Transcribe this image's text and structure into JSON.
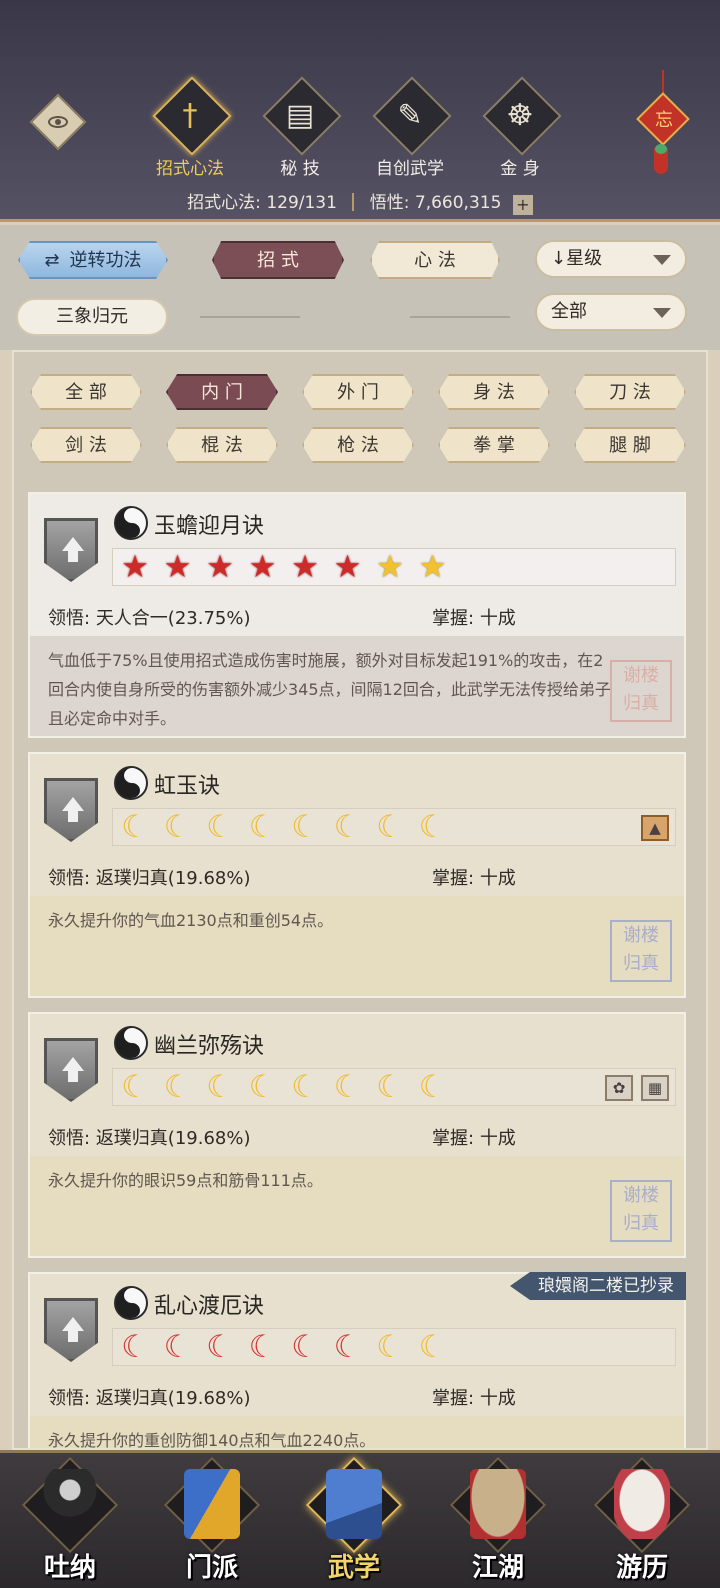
{
  "header": {
    "tabs": [
      {
        "label": "招式心法",
        "icon": "sword-icon",
        "glyph": "†",
        "active": true
      },
      {
        "label": "秘 技",
        "icon": "book-icon",
        "glyph": "▤",
        "active": false
      },
      {
        "label": "自创武学",
        "icon": "scroll-brush-icon",
        "glyph": "✎",
        "active": false
      },
      {
        "label": "金 身",
        "icon": "meditation-icon",
        "glyph": "☸",
        "active": false
      }
    ],
    "knot_char": "忘",
    "stats": {
      "count_label": "招式心法:",
      "count_value": "129/131",
      "insight_label": "悟性:",
      "insight_value": "7,660,315",
      "plus": "+"
    }
  },
  "filters": {
    "reverse_label": "逆转功法",
    "reverse_icon": "⇄",
    "moves_label": "招 式",
    "mind_label": "心 法",
    "sort_label": "↓星级",
    "sanxiang_label": "三象归元",
    "all_label": "全部"
  },
  "categories": [
    "全 部",
    "内 门",
    "外 门",
    "身 法",
    "刀 法",
    "剑 法",
    "棍 法",
    "枪 法",
    "拳 掌",
    "腿 脚"
  ],
  "active_category": 1,
  "field_labels": {
    "comprehension": "领悟:",
    "mastery": "掌握:"
  },
  "skills": [
    {
      "name": "玉蟾迎月诀",
      "marks": [
        "star-red",
        "star-red",
        "star-red",
        "star-red",
        "star-red",
        "star-red",
        "star-gold",
        "star-gold"
      ],
      "comprehension": "天人合一(23.75%)",
      "mastery": "十成",
      "description": "气血低于75%且使用招式造成伤害时施展，额外对目标发起191%的攻击，在2回合内使自身所受的伤害额外减少345点，间隔12回合，此武学无法传授给弟子且必定命中对手。",
      "seal": "谢楼 归真",
      "tags": [],
      "ribbon": ""
    },
    {
      "name": "虹玉诀",
      "marks": [
        "moon-gold",
        "moon-gold",
        "moon-gold",
        "moon-gold",
        "moon-gold",
        "moon-gold",
        "moon-gold",
        "moon-gold"
      ],
      "comprehension": "返璞归真(19.68%)",
      "mastery": "十成",
      "description": "永久提升你的气血2130点和重创54点。",
      "seal": "谢楼 归真",
      "tags": [
        "mountain-icon"
      ],
      "ribbon": ""
    },
    {
      "name": "幽兰弥殇诀",
      "marks": [
        "moon-gold",
        "moon-gold",
        "moon-gold",
        "moon-gold",
        "moon-gold",
        "moon-gold",
        "moon-gold",
        "moon-gold"
      ],
      "comprehension": "返璞归真(19.68%)",
      "mastery": "十成",
      "description": "永久提升你的眼识59点和筋骨111点。",
      "seal": "谢楼 归真",
      "tags": [
        "flower-icon",
        "tile-icon"
      ],
      "ribbon": ""
    },
    {
      "name": "乱心渡厄诀",
      "marks": [
        "moon-red",
        "moon-red",
        "moon-red",
        "moon-red",
        "moon-red",
        "moon-red",
        "moon-gold",
        "moon-gold"
      ],
      "comprehension": "返璞归真(19.68%)",
      "mastery": "十成",
      "description": "永久提升你的重创防御140点和气血2240点。",
      "seal": "",
      "tags": [],
      "ribbon": "琅嬛阁二楼已抄录"
    }
  ],
  "bottom_nav": [
    {
      "label": "吐纳",
      "icon": "breathing-figure-icon",
      "active": false
    },
    {
      "label": "门派",
      "icon": "sect-banner-icon",
      "active": false
    },
    {
      "label": "武学",
      "icon": "martial-book-icon",
      "active": true
    },
    {
      "label": "江湖",
      "icon": "straw-hat-icon",
      "active": false
    },
    {
      "label": "游历",
      "icon": "horse-icon",
      "active": false
    }
  ]
}
